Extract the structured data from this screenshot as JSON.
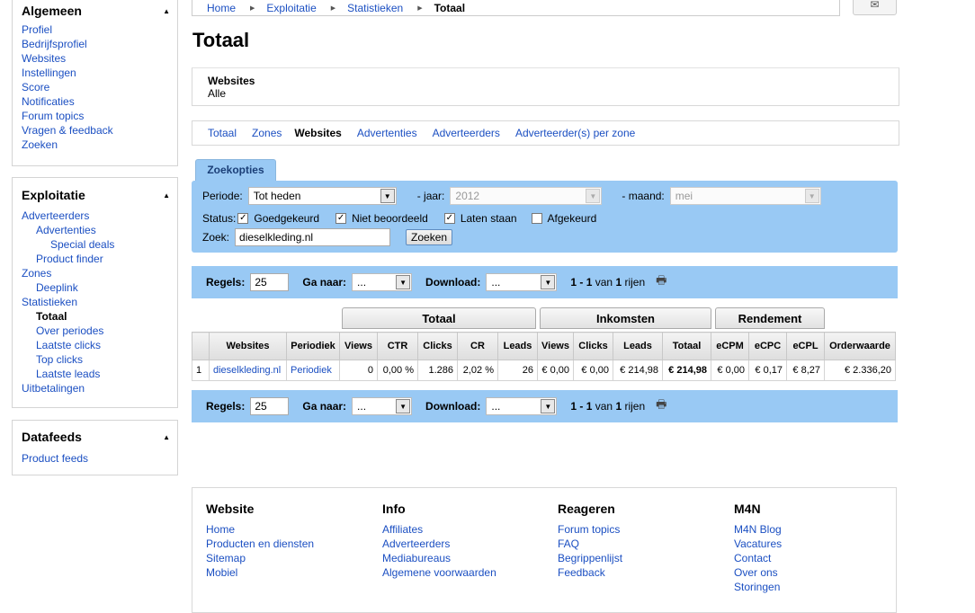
{
  "sidebar": {
    "algemeen": {
      "title": "Algemeen",
      "items": [
        "Profiel",
        "Bedrijfsprofiel",
        "Websites",
        "Instellingen",
        "Score",
        "Notificaties",
        "Forum topics",
        "Vragen & feedback",
        "Zoeken"
      ]
    },
    "exploitatie": {
      "title": "Exploitatie",
      "items": [
        {
          "label": "Adverteerders",
          "level": 0
        },
        {
          "label": "Advertenties",
          "level": 1
        },
        {
          "label": "Special deals",
          "level": 2
        },
        {
          "label": "Product finder",
          "level": 1
        },
        {
          "label": "Zones",
          "level": 0
        },
        {
          "label": "Deeplink",
          "level": 1
        },
        {
          "label": "Statistieken",
          "level": 0
        },
        {
          "label": "Totaal",
          "level": 1,
          "current": true
        },
        {
          "label": "Over periodes",
          "level": 1
        },
        {
          "label": "Laatste clicks",
          "level": 1
        },
        {
          "label": "Top clicks",
          "level": 1
        },
        {
          "label": "Laatste leads",
          "level": 1
        },
        {
          "label": "Uitbetalingen",
          "level": 0
        }
      ]
    },
    "datafeeds": {
      "title": "Datafeeds",
      "items": [
        "Product feeds"
      ]
    }
  },
  "breadcrumb": [
    "Home",
    "Exploitatie",
    "Statistieken",
    "Totaal"
  ],
  "page_title": "Totaal",
  "websites_box": {
    "label": "Websites",
    "value": "Alle"
  },
  "subnav": {
    "items": [
      "Totaal",
      "Zones",
      "Websites",
      "Advertenties",
      "Adverteerders",
      "Adverteerder(s) per zone"
    ],
    "active": "Websites"
  },
  "search": {
    "tab": "Zoekopties",
    "periode_label": "Periode:",
    "periode_value": "Tot heden",
    "jaar_label": "- jaar:",
    "jaar_value": "2012",
    "maand_label": "- maand:",
    "maand_value": "mei",
    "status_label": "Status:",
    "statuses": [
      {
        "label": "Goedgekeurd",
        "checked": true
      },
      {
        "label": "Niet beoordeeld",
        "checked": true
      },
      {
        "label": "Laten staan",
        "checked": true
      },
      {
        "label": "Afgekeurd",
        "checked": false
      }
    ],
    "zoek_label": "Zoek:",
    "zoek_value": "dieselkleding.nl",
    "zoek_button": "Zoeken"
  },
  "pager": {
    "regels_label": "Regels:",
    "regels_value": "25",
    "ganaar_label": "Ga naar:",
    "ganaar_value": "...",
    "download_label": "Download:",
    "download_value": "...",
    "range": "1 - 1",
    "van": "van",
    "total": "1",
    "rijen": "rijen"
  },
  "table": {
    "groups": [
      "Totaal",
      "Inkomsten",
      "Rendement"
    ],
    "headers": [
      "",
      "Websites",
      "Periodiek",
      "Views",
      "CTR",
      "Clicks",
      "CR",
      "Leads",
      "Views",
      "Clicks",
      "Leads",
      "Totaal",
      "eCPM",
      "eCPC",
      "eCPL",
      "Orderwaarde"
    ],
    "rows": [
      [
        "1",
        "dieselkleding.nl",
        "Periodiek",
        "0",
        "0,00 %",
        "1.286",
        "2,02 %",
        "26",
        "€ 0,00",
        "€ 0,00",
        "€ 214,98",
        "€ 214,98",
        "€ 0,00",
        "€ 0,17",
        "€ 8,27",
        "€ 2.336,20"
      ]
    ]
  },
  "footer": {
    "cols": [
      {
        "title": "Website",
        "links": [
          "Home",
          "Producten en diensten",
          "Sitemap",
          "Mobiel"
        ]
      },
      {
        "title": "Info",
        "links": [
          "Affiliates",
          "Adverteerders",
          "Mediabureaus",
          "Algemene voorwaarden"
        ]
      },
      {
        "title": "Reageren",
        "links": [
          "Forum topics",
          "FAQ",
          "Begrippenlijst",
          "Feedback"
        ]
      },
      {
        "title": "M4N",
        "links": [
          "M4N Blog",
          "Vacatures",
          "Contact",
          "Over ons",
          "Storingen"
        ]
      }
    ]
  }
}
